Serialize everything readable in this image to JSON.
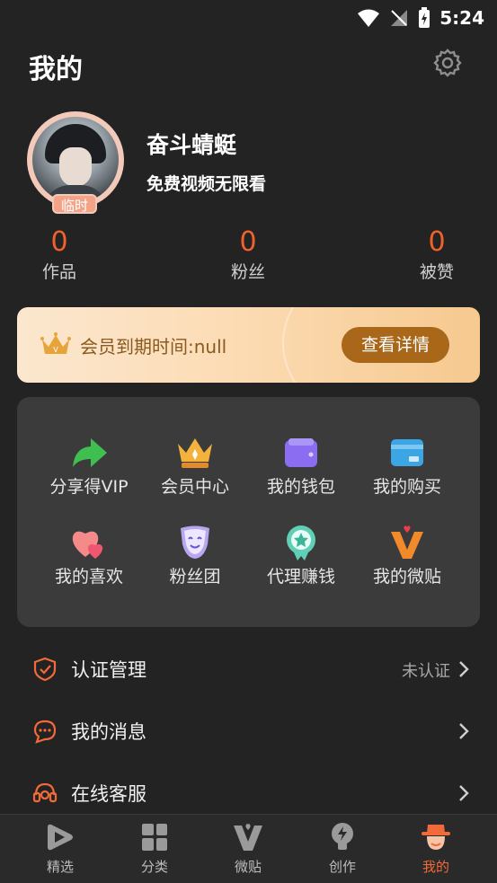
{
  "status_bar": {
    "time": "5:24"
  },
  "header": {
    "title": "我的"
  },
  "profile": {
    "temp_badge": "临时",
    "username": "奋斗蜻蜓",
    "tagline": "免费视频无限看"
  },
  "stats": [
    {
      "value": "0",
      "label": "作品"
    },
    {
      "value": "0",
      "label": "粉丝"
    },
    {
      "value": "0",
      "label": "被赞"
    }
  ],
  "vip": {
    "expire_text": "会员到期时间:null",
    "detail_button": "查看详情"
  },
  "grid": [
    {
      "label": "分享得VIP",
      "icon": "share-arrow-icon"
    },
    {
      "label": "会员中心",
      "icon": "crown-icon"
    },
    {
      "label": "我的钱包",
      "icon": "wallet-icon"
    },
    {
      "label": "我的购买",
      "icon": "card-icon"
    },
    {
      "label": "我的喜欢",
      "icon": "hearts-icon"
    },
    {
      "label": "粉丝团",
      "icon": "mask-icon"
    },
    {
      "label": "代理赚钱",
      "icon": "star-badge-icon"
    },
    {
      "label": "我的微贴",
      "icon": "v-heart-icon"
    }
  ],
  "menu": [
    {
      "label": "认证管理",
      "value": "未认证",
      "icon": "shield-icon"
    },
    {
      "label": "我的消息",
      "value": "",
      "icon": "message-icon"
    },
    {
      "label": "在线客服",
      "value": "",
      "icon": "headset-icon"
    }
  ],
  "tabs": [
    {
      "label": "精选",
      "icon": "play-icon"
    },
    {
      "label": "分类",
      "icon": "grid-icon"
    },
    {
      "label": "微贴",
      "icon": "v-icon"
    },
    {
      "label": "创作",
      "icon": "bulb-icon"
    },
    {
      "label": "我的",
      "icon": "profile-hat-icon",
      "active": true
    }
  ],
  "colors": {
    "accent": "#f0622b",
    "background": "#232323",
    "card": "#3b3b3b",
    "vip_button": "#a9671a"
  }
}
